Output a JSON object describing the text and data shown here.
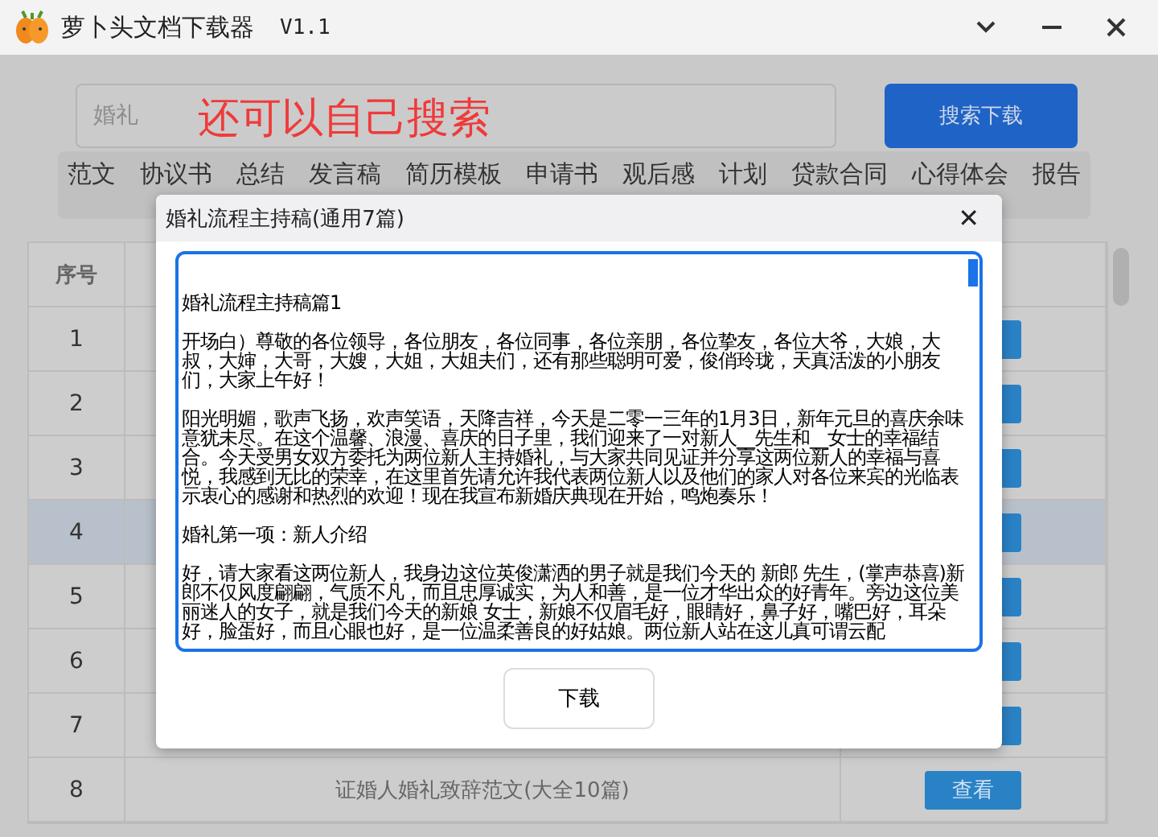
{
  "window": {
    "title": "萝卜头文档下载器",
    "version": "V1.1"
  },
  "search": {
    "value": "婚礼",
    "button": "搜索下载"
  },
  "annotation": "还可以自己搜索",
  "tabs": [
    {
      "label": "范文"
    },
    {
      "label": "协议书"
    },
    {
      "label": "总结"
    },
    {
      "label": "发言稿"
    },
    {
      "label": "简历模板"
    },
    {
      "label": "申请书"
    },
    {
      "label": "观后感"
    },
    {
      "label": "计划"
    },
    {
      "label": "贷款合同"
    },
    {
      "label": "心得体会"
    },
    {
      "label": "报告"
    }
  ],
  "table": {
    "columns": [
      "序号"
    ],
    "rows": [
      {
        "number": "1",
        "selected": false
      },
      {
        "number": "2",
        "selected": false
      },
      {
        "number": "3",
        "selected": false
      },
      {
        "number": "4",
        "selected": true
      },
      {
        "number": "5",
        "selected": false
      },
      {
        "number": "6",
        "selected": false
      },
      {
        "number": "7",
        "selected": false
      },
      {
        "number": "8",
        "selected": false,
        "title": "证婚人婚礼致辞范文(大全10篇)",
        "action": "查看"
      }
    ]
  },
  "dialog": {
    "title": "婚礼流程主持稿(通用7篇)",
    "close": "✕",
    "paragraphs": [
      "婚礼流程主持稿篇1",
      "开场白）尊敬的各位领导，各位朋友，各位同事，各位亲朋，各位挚友，各位大爷，大娘，大叔，大婶，大哥，大嫂，大姐，大姐夫们，还有那些聪明可爱，俊俏玲珑，天真活泼的小朋友们，大家上午好！",
      "阳光明媚，歌声飞扬，欢声笑语，天降吉祥，今天是二零一三年的1月3日，新年元旦的喜庆余味意犹未尽。在这个温馨、浪漫、喜庆的日子里，我们迎来了一对新人__先生和__女士的幸福结合。今天受男女双方委托为两位新人主持婚礼，与大家共同见证并分享这两位新人的幸福与喜悦，我感到无比的荣幸，在这里首先请允许我代表两位新人以及他们的家人对各位来宾的光临表示衷心的感谢和热烈的欢迎！现在我宣布新婚庆典现在开始，鸣炮奏乐！",
      "婚礼第一项：新人介绍",
      "好，请大家看这两位新人，我身边这位英俊潇洒的男子就是我们今天的 新郎 先生，(掌声恭喜)新郎不仅风度翩翩，气质不凡，而且忠厚诚实，为人和善，是一位才华出众的好青年。旁边这位美丽迷人的女子，就是我们今天的新娘 女士，新娘不仅眉毛好，眼睛好，鼻子好，嘴巴好，耳朵好，脸蛋好，而且心眼也好，是一位温柔善良的好姑娘。两位新人站在这儿真可谓云配"
    ],
    "button": "下载"
  }
}
